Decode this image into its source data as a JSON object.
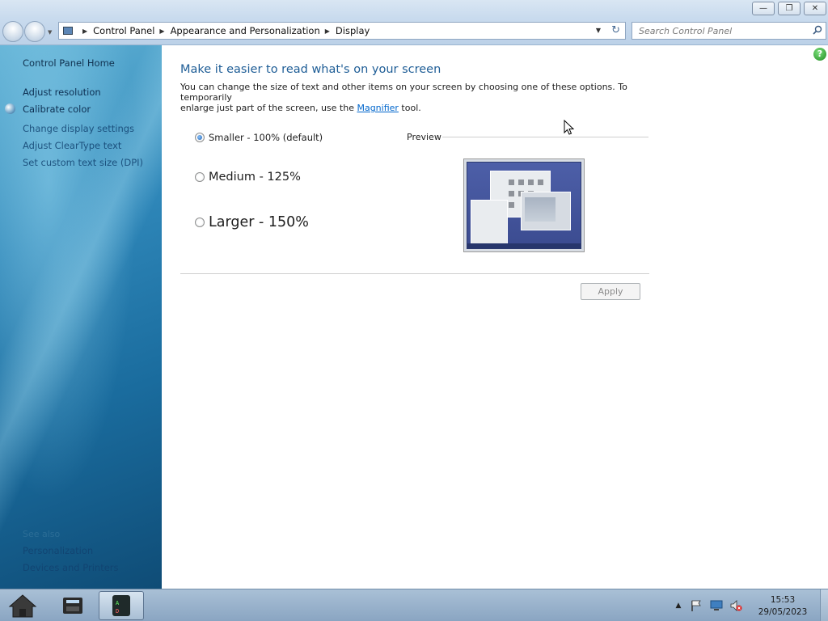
{
  "window": {
    "min_icon": "minimize-icon",
    "max_icon": "restore-icon",
    "close_icon": "close-icon"
  },
  "address": {
    "crumbs": [
      "Control Panel",
      "Appearance and Personalization",
      "Display"
    ],
    "search_placeholder": "Search Control Panel"
  },
  "sidebar": {
    "home": "Control Panel Home",
    "links": [
      "Adjust resolution",
      "Calibrate color",
      "Change display settings",
      "Adjust ClearType text",
      "Set custom text size (DPI)"
    ],
    "see_also_title": "See also",
    "see_also": [
      "Personalization",
      "Devices and Printers"
    ]
  },
  "main": {
    "heading": "Make it easier to read what's on your screen",
    "desc_line1": "You can change the size of text and other items on your screen by choosing one of these options. To temporarily",
    "desc_pre": "enlarge just part of the screen, use the ",
    "desc_link": "Magnifier",
    "desc_post": " tool.",
    "options": [
      {
        "label": "Smaller - 100% (default)",
        "checked": true
      },
      {
        "label": "Medium - 125%",
        "checked": false
      },
      {
        "label": "Larger - 150%",
        "checked": false
      }
    ],
    "preview_label": "Preview",
    "apply_label": "Apply"
  },
  "taskbar": {
    "time": "15:53",
    "date": "29/05/2023"
  },
  "colors": {
    "heading": "#1e5d96",
    "link": "#0066cc",
    "sidebar_dark": "#0f4c76"
  }
}
